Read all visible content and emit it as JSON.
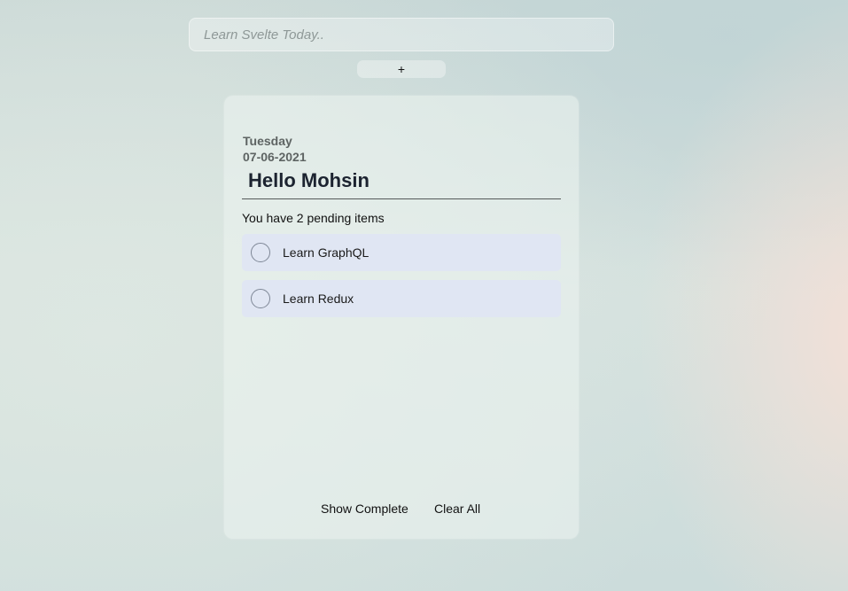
{
  "input": {
    "placeholder": "Learn Svelte Today..",
    "value": ""
  },
  "add_button": {
    "label": "+"
  },
  "card": {
    "day": "Tuesday",
    "date": "07-06-2021",
    "greeting": "Hello Mohsin",
    "pending_text": "You have 2 pending items",
    "todos": [
      {
        "label": "Learn GraphQL",
        "completed": false
      },
      {
        "label": "Learn Redux",
        "completed": false
      }
    ],
    "footer": {
      "show_complete_label": "Show Complete",
      "clear_all_label": "Clear All"
    }
  },
  "colors": {
    "todo_item_bg": "#e0e6f3",
    "heading_text": "#1c2330",
    "muted_text": "#5e6463"
  },
  "icons": {
    "todo_check": "circle-checkbox-icon"
  }
}
